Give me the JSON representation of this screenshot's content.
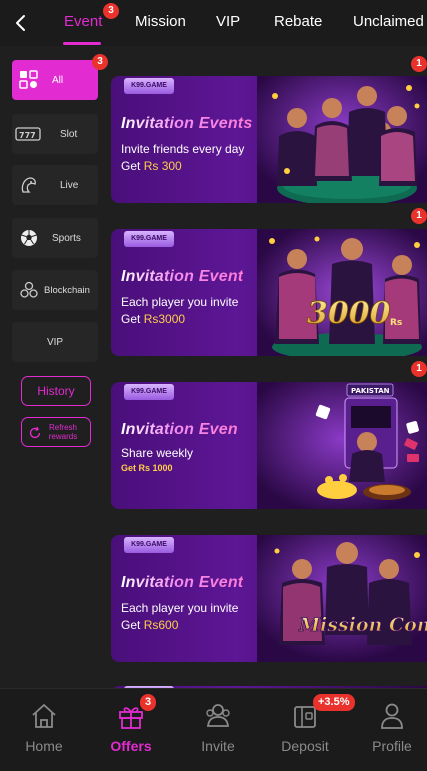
{
  "tabs": [
    {
      "label": "Event",
      "badge": "3"
    },
    {
      "label": "Mission"
    },
    {
      "label": "VIP"
    },
    {
      "label": "Rebate"
    },
    {
      "label": "Unclaimed"
    }
  ],
  "sidebar": {
    "categories": [
      {
        "label": "All",
        "badge": "3",
        "icon": "grid-icon"
      },
      {
        "label": "Slot",
        "icon": "slot-icon"
      },
      {
        "label": "Live",
        "icon": "live-icon"
      },
      {
        "label": "Sports",
        "icon": "soccer-ball-icon"
      },
      {
        "label": "Blockchain",
        "icon": "blockchain-icon"
      },
      {
        "label": "VIP"
      }
    ],
    "history_label": "History",
    "refresh_label": "Refresh rewards"
  },
  "banners": [
    {
      "logo": "K99.GAME",
      "title": "Invitation Events",
      "line1": "Invite friends every day",
      "line2_prefix": "Get ",
      "line2_value": "Rs 300",
      "badge": "1"
    },
    {
      "logo": "K99.GAME",
      "title": "Invitation Event",
      "line1": "Each player you invite",
      "line2_prefix": "Get ",
      "line2_value": "Rs3000",
      "art_text": "3000",
      "art_unit": "Rs",
      "badge": "1"
    },
    {
      "logo": "K99.GAME",
      "title": "Invitation Even",
      "line1": "Share weekly",
      "line2_prefix": "Get ",
      "line2_value": "Rs 1000",
      "art_text": "PAKISTAN",
      "badge": "1"
    },
    {
      "logo": "K99.GAME",
      "title": "Invitation Event",
      "line1": "Each player you invite",
      "line2_prefix": "Get ",
      "line2_value": "Rs600",
      "art_text": "Mission Completed"
    }
  ],
  "bottom_nav": [
    {
      "label": "Home",
      "icon": "home-icon"
    },
    {
      "label": "Offers",
      "icon": "gift-icon",
      "badge": "3"
    },
    {
      "label": "Invite",
      "icon": "invite-icon"
    },
    {
      "label": "Deposit",
      "icon": "wallet-icon",
      "badge": "+3.5%"
    },
    {
      "label": "Profile",
      "icon": "profile-icon"
    }
  ],
  "colors": {
    "accent": "#e22bd0",
    "badge": "#e8322b",
    "background": "#1f1f1f"
  }
}
